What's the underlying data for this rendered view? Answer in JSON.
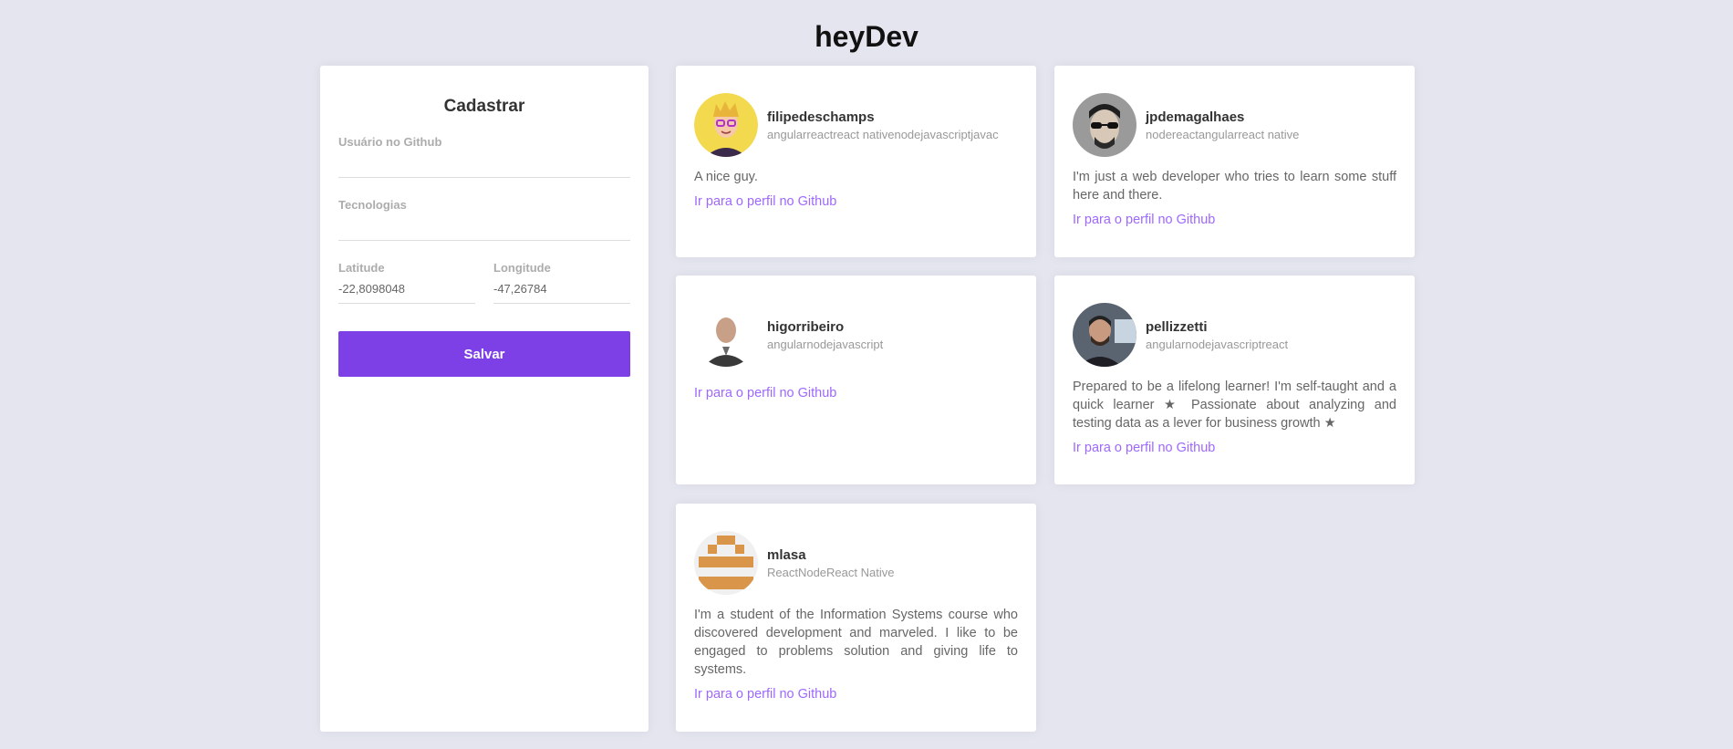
{
  "app": {
    "title": "heyDev"
  },
  "form": {
    "heading": "Cadastrar",
    "github_user_label": "Usuário no Github",
    "github_user_value": "",
    "techs_label": "Tecnologias",
    "techs_value": "",
    "latitude_label": "Latitude",
    "latitude_value": "-22,8098048",
    "longitude_label": "Longitude",
    "longitude_value": "-47,26784",
    "save_label": "Salvar"
  },
  "devs": [
    {
      "username": "filipedeschamps",
      "techs": "angularreactreact nativenodejavascriptjavac",
      "bio": "A nice guy.",
      "link": "Ir para o perfil no Github",
      "avatar_icon": "cartoon-avatar"
    },
    {
      "username": "jpdemagalhaes",
      "techs": "nodereactangularreact native",
      "bio": "I'm just a web developer who tries to learn some stuff here and there.",
      "link": "Ir para o perfil no Github",
      "avatar_icon": "photo-avatar"
    },
    {
      "username": "higorribeiro",
      "techs": "angularnodejavascript",
      "bio": "",
      "link": "Ir para o perfil no Github",
      "avatar_icon": "photo-avatar"
    },
    {
      "username": "pellizzetti",
      "techs": "angularnodejavascriptreact",
      "bio": "Prepared to be a lifelong learner! I'm self-taught and a quick learner ★ Passionate about analyzing and testing data as a lever for business growth ★",
      "link": "Ir para o perfil no Github",
      "avatar_icon": "photo-avatar"
    },
    {
      "username": "mlasa",
      "techs": "ReactNodeReact Native",
      "bio": "I'm a student of the Information Systems course who discovered development and marveled. I like to be engaged to problems solution and giving life to systems.",
      "link": "Ir para o perfil no Github",
      "avatar_icon": "identicon-avatar"
    }
  ],
  "colors": {
    "background": "#e5e5ef",
    "accent": "#7d40e7",
    "link": "#8e4dff"
  }
}
